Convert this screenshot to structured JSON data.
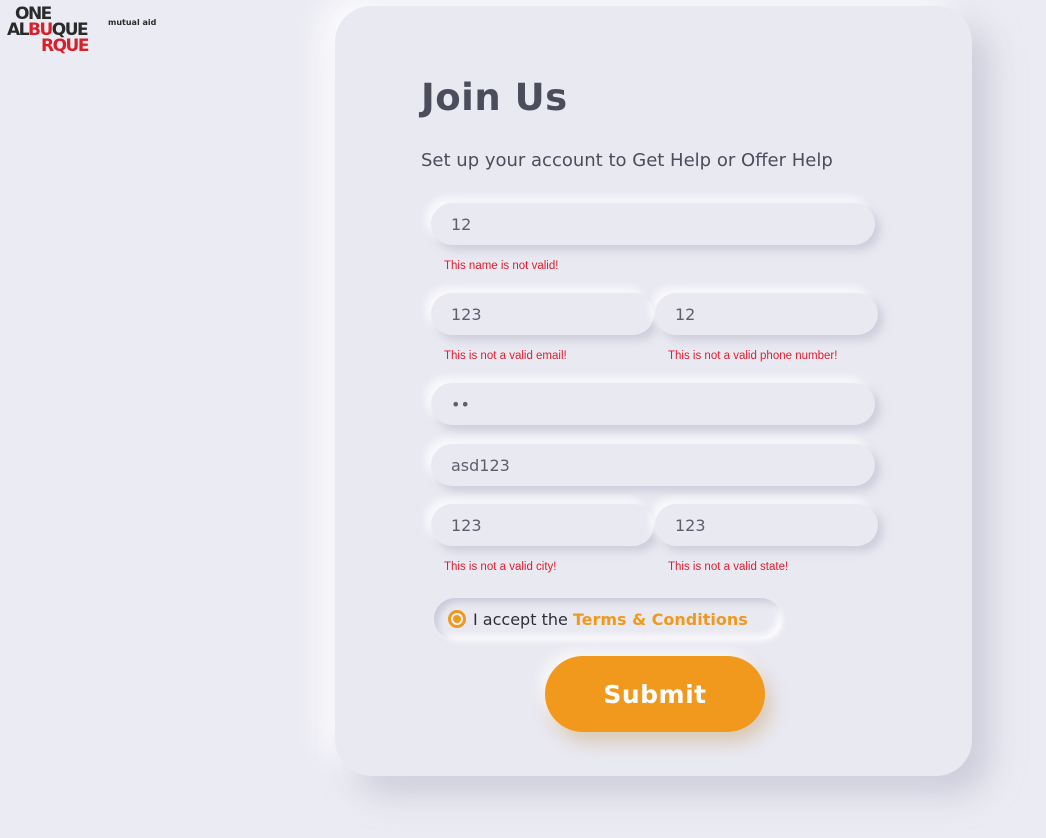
{
  "logo": {
    "line1": "ONE",
    "line2_prefix": "AL",
    "line2_red": "BU",
    "line2_suffix": "QUE",
    "line3": "RQUE",
    "tagline": "mutual aid",
    "brand_color": "#d9202a"
  },
  "form": {
    "title": "Join Us",
    "subtitle": "Set up your account to Get Help or Offer Help",
    "name": {
      "value": "12",
      "error": "This name is not valid!"
    },
    "email": {
      "value": "123",
      "error": "This is not a valid email!"
    },
    "phone": {
      "value": "12",
      "error": "This is not a valid phone number!"
    },
    "password": {
      "value": "••"
    },
    "address": {
      "value": "asd123"
    },
    "city": {
      "value": "123",
      "error": "This is not a valid city!"
    },
    "state": {
      "value": "123",
      "error": "This is not a valid state!"
    },
    "terms": {
      "prefix": "I accept the",
      "link": "Terms & Conditions",
      "checked": true
    },
    "submit_label": "Submit"
  },
  "colors": {
    "accent": "#f0991d",
    "error": "#e01d2e",
    "background": "#ebebf3",
    "text": "#4b4d5c"
  }
}
